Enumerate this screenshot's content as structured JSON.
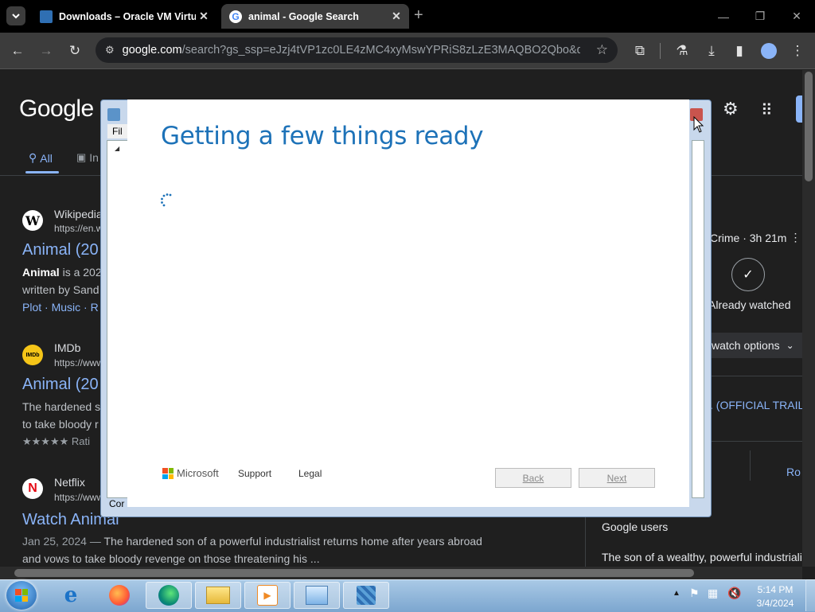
{
  "browser": {
    "tabs": [
      {
        "title": "Downloads – Oracle VM Virtua",
        "active": false
      },
      {
        "title": "animal - Google Search",
        "active": true
      }
    ],
    "new_tab_glyph": "+",
    "url_host": "google.com",
    "url_path": "/search?gs_ssp=eJzj4tVP1zc0LE4zMC4xyMswYPRiS8zLzE3MAQBO2Qbo&q=ani..."
  },
  "google": {
    "logo": "Google",
    "tabs": {
      "all": "All",
      "images": "In"
    },
    "results": [
      {
        "source": "Wikipedia",
        "url": "https://en.w",
        "title": "Animal (20",
        "snippet_bold": "Animal",
        "snippet": " is a 202",
        "snippet2": "written by Sand",
        "links": "Plot · Music · R"
      },
      {
        "source": "IMDb",
        "url": "https://www",
        "title": "Animal (20",
        "snippet": "The hardened s",
        "snippet2": "to take bloody r",
        "rating": "★★★★★ Rati"
      },
      {
        "source": "Netflix",
        "url": "https://www",
        "title": "Watch Animal",
        "date": "Jan 25, 2024 — ",
        "snippet": "The hardened son of a powerful industrialist returns home after years abroad",
        "snippet2": "and vows to take bloody revenge on those threatening his ..."
      }
    ],
    "panel": {
      "meta": "Crime · 3h 21m",
      "watched": "Already watched",
      "watch_options": "watch options",
      "trailer": ". (OFFICIAL TRAIL",
      "ro": "Ro",
      "google_users": "Google users",
      "summary": "The son of a wealthy, powerful industriali"
    }
  },
  "legacy_window": {
    "menu_partial": "Fil",
    "status_partial": "Cor"
  },
  "setup": {
    "title": "Getting a few things ready",
    "brand": "Microsoft",
    "support": "Support",
    "legal": "Legal",
    "back": "Back",
    "next": "Next"
  },
  "taskbar": {
    "time": "5:14 PM",
    "date": "3/4/2024"
  },
  "colors": {
    "google_link": "#8ab4f8",
    "setup_title": "#1d72b8",
    "dark_bg": "#1f1f1f"
  }
}
